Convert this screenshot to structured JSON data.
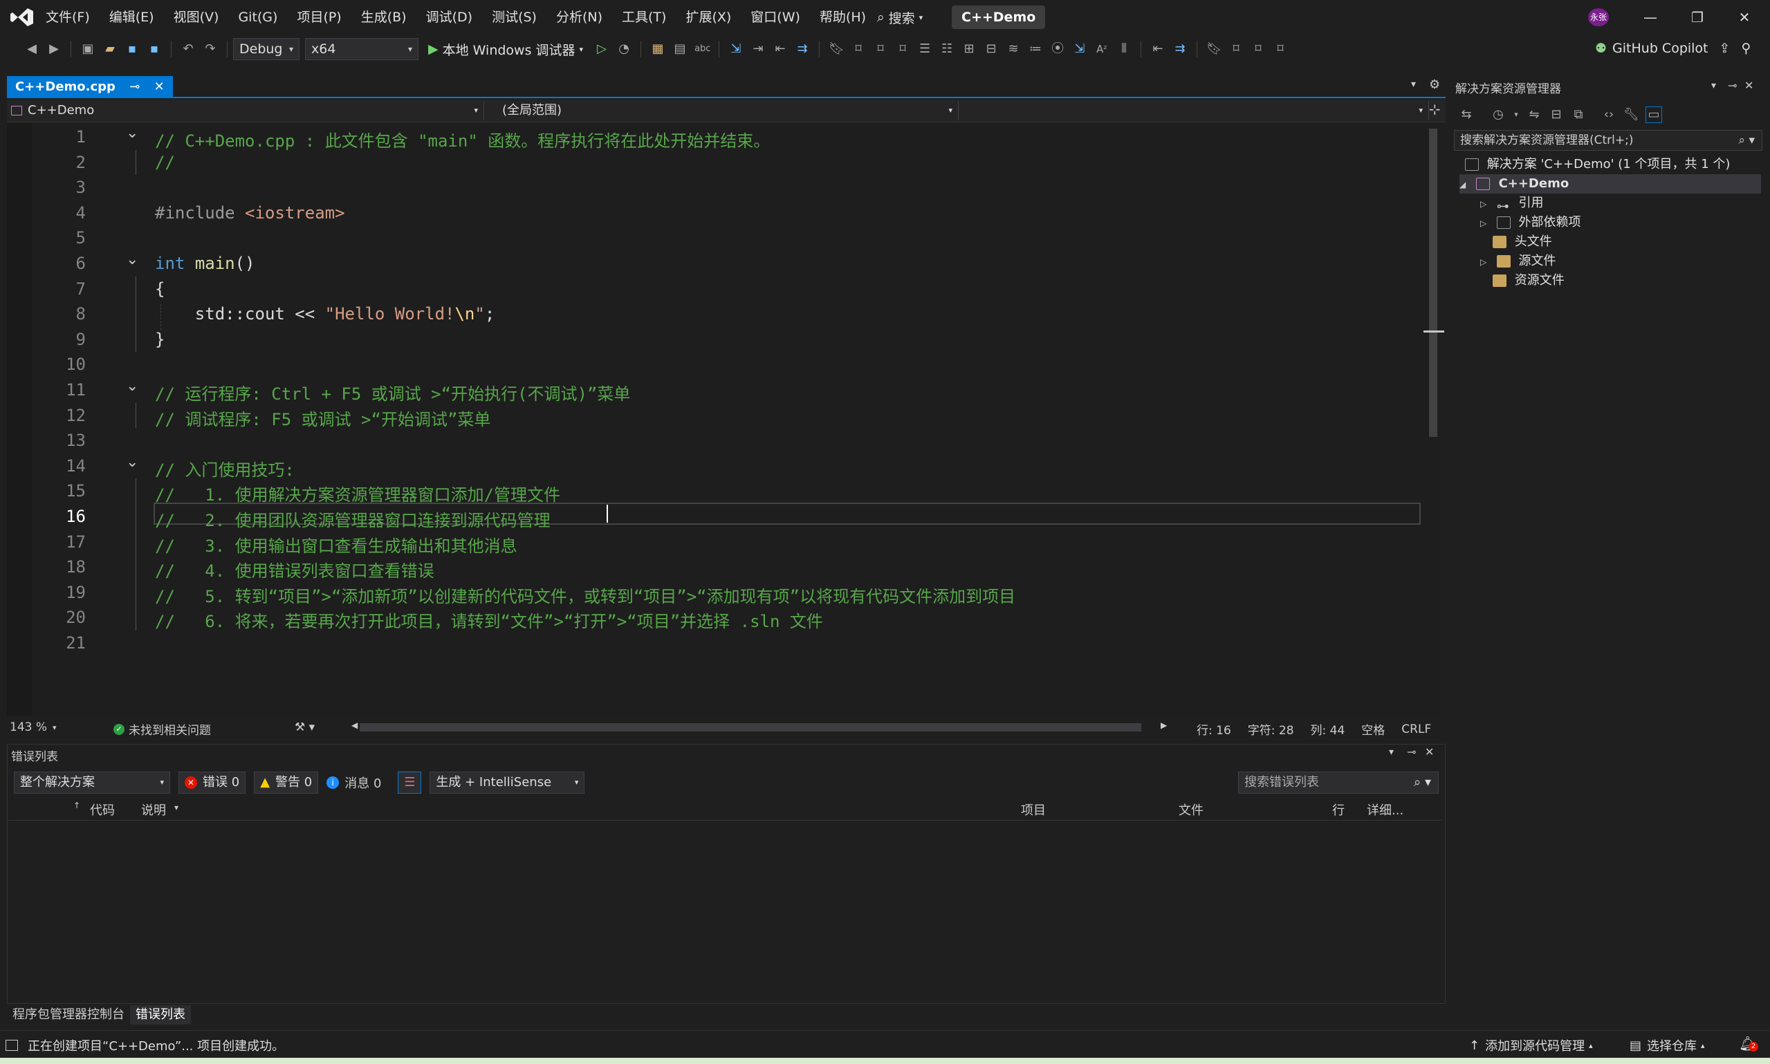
{
  "app": {
    "title": "C++Demo",
    "avatar_initials": "永张",
    "search_label": "搜索",
    "accent": "#0078d4"
  },
  "menu": [
    "文件(F)",
    "编辑(E)",
    "视图(V)",
    "Git(G)",
    "项目(P)",
    "生成(B)",
    "调试(D)",
    "测试(S)",
    "分析(N)",
    "工具(T)",
    "扩展(X)",
    "窗口(W)",
    "帮助(H)"
  ],
  "toolbar": {
    "config": "Debug",
    "platform": "x64",
    "run_label": "本地 Windows 调试器",
    "copilot_label": "GitHub Copilot"
  },
  "editor": {
    "tab_label": "C++Demo.cpp",
    "nav_project": "C++Demo",
    "nav_scope": "(全局范围)",
    "current_line": "16",
    "lines": [
      {
        "n": "1",
        "fold": "⌄",
        "segs": [
          {
            "c": "cmt",
            "t": "// C++Demo.cpp : 此文件包含 \"main\" 函数。程序执行将在此处开始并结束。"
          }
        ]
      },
      {
        "n": "2",
        "segs": [
          {
            "c": "cmt",
            "t": "//"
          }
        ]
      },
      {
        "n": "3",
        "segs": []
      },
      {
        "n": "4",
        "segs": [
          {
            "c": "pp",
            "t": "#include "
          },
          {
            "c": "inc",
            "t": "<iostream>"
          }
        ]
      },
      {
        "n": "5",
        "segs": []
      },
      {
        "n": "6",
        "fold": "⌄",
        "segs": [
          {
            "c": "kw",
            "t": "int"
          },
          {
            "c": "",
            "t": " "
          },
          {
            "c": "fn",
            "t": "main"
          },
          {
            "c": "",
            "t": "()"
          }
        ]
      },
      {
        "n": "7",
        "segs": [
          {
            "c": "",
            "t": "{"
          }
        ]
      },
      {
        "n": "8",
        "segs": [
          {
            "c": "",
            "t": "    std::cout << "
          },
          {
            "c": "str",
            "t": "\"Hello World!"
          },
          {
            "c": "esc",
            "t": "\\n"
          },
          {
            "c": "str",
            "t": "\""
          },
          {
            "c": "",
            "t": ";"
          }
        ]
      },
      {
        "n": "9",
        "segs": [
          {
            "c": "",
            "t": "}"
          }
        ]
      },
      {
        "n": "10",
        "segs": []
      },
      {
        "n": "11",
        "fold": "⌄",
        "segs": [
          {
            "c": "cmt",
            "t": "// 运行程序: Ctrl + F5 或调试 >“开始执行(不调试)”菜单"
          }
        ]
      },
      {
        "n": "12",
        "segs": [
          {
            "c": "cmt",
            "t": "// 调试程序: F5 或调试 >“开始调试”菜单"
          }
        ]
      },
      {
        "n": "13",
        "segs": []
      },
      {
        "n": "14",
        "fold": "⌄",
        "segs": [
          {
            "c": "cmt",
            "t": "// 入门使用技巧:"
          }
        ]
      },
      {
        "n": "15",
        "segs": [
          {
            "c": "cmt",
            "t": "//   1. 使用解决方案资源管理器窗口添加/管理文件"
          }
        ]
      },
      {
        "n": "16",
        "segs": [
          {
            "c": "cmt",
            "t": "//   2. 使用团队资源管理器窗口连接到源代码管理"
          }
        ]
      },
      {
        "n": "17",
        "segs": [
          {
            "c": "cmt",
            "t": "//   3. 使用输出窗口查看生成输出和其他消息"
          }
        ]
      },
      {
        "n": "18",
        "segs": [
          {
            "c": "cmt",
            "t": "//   4. 使用错误列表窗口查看错误"
          }
        ]
      },
      {
        "n": "19",
        "segs": [
          {
            "c": "cmt",
            "t": "//   5. 转到“项目”>“添加新项”以创建新的代码文件，或转到“项目”>“添加现有项”以将现有代码文件添加到项目"
          }
        ]
      },
      {
        "n": "20",
        "segs": [
          {
            "c": "cmt",
            "t": "//   6. 将来，若要再次打开此项目，请转到“文件”>“打开”>“项目”并选择 .sln 文件"
          }
        ]
      },
      {
        "n": "21",
        "segs": []
      }
    ]
  },
  "editor_status": {
    "zoom": "143 %",
    "issues": "未找到相关问题",
    "row": "行: 16",
    "char": "字符: 28",
    "col": "列: 44",
    "indent": "空格",
    "eol": "CRLF"
  },
  "error_list": {
    "title": "错误列表",
    "scope": "整个解决方案",
    "errors": "错误 0",
    "warnings": "警告 0",
    "messages": "消息 0",
    "filter": "生成 + IntelliSense",
    "search_placeholder": "搜索错误列表",
    "columns": {
      "code": "代码",
      "desc": "说明",
      "project": "项目",
      "file": "文件",
      "line": "行",
      "detail": "详细..."
    }
  },
  "bottom_tabs": [
    "程序包管理器控制台",
    "错误列表"
  ],
  "solution_explorer": {
    "title": "解决方案资源管理器",
    "search_placeholder": "搜索解决方案资源管理器(Ctrl+;)",
    "solution": "解决方案 'C++Demo' (1 个项目，共 1 个)",
    "project": "C++Demo",
    "items": [
      "引用",
      "外部依赖项",
      "头文件",
      "源文件",
      "资源文件"
    ]
  },
  "statusbar": {
    "message": "正在创建项目“C++Demo”... 项目创建成功。",
    "source_control": "添加到源代码管理",
    "repo": "选择仓库",
    "notifications": "2"
  }
}
